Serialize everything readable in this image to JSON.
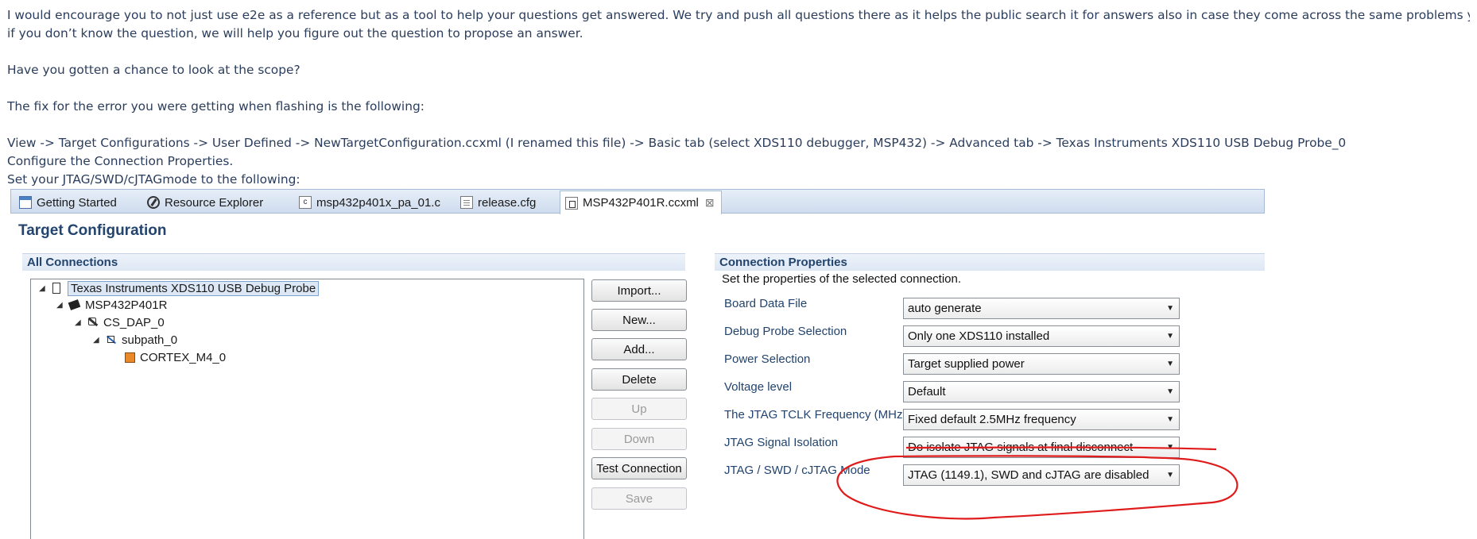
{
  "post": {
    "line1": "I would encourage you to not just use e2e as a reference but as a tool to help your questions get answered. We try and push all questions there as it helps the public search it for answers also in case they come across the same problems you do. Even",
    "line2": "if you don’t know the question, we will help you figure out the question to propose an answer.",
    "line3": "Have you gotten a chance to look at the scope?",
    "line4": "The fix for the error you were getting when flashing is the following:",
    "line5": "View -> Target Configurations -> User Defined -> NewTargetConfiguration.ccxml (I renamed this file) -> Basic tab (select XDS110 debugger, MSP432) -> Advanced tab -> Texas Instruments XDS110 USB Debug Probe_0",
    "line6": "Configure the Connection Properties.",
    "line7": "Set your JTAG/SWD/cJTAGmode to the following:"
  },
  "tabs": [
    {
      "label": "Getting Started",
      "icon": "window-icon"
    },
    {
      "label": "Resource Explorer",
      "icon": "compass-icon"
    },
    {
      "label": "msp432p401x_pa_01.c",
      "icon": "c-file-icon"
    },
    {
      "label": "release.cfg",
      "icon": "document-icon"
    },
    {
      "label": "MSP432P401R.ccxml",
      "icon": "ccxml-file-icon",
      "close": "⊠"
    }
  ],
  "target_config": {
    "title": "Target Configuration",
    "all_connections": "All Connections",
    "tree": [
      {
        "label": "Texas Instruments XDS110 USB Debug Probe",
        "icon": "probe-icon"
      },
      {
        "label": "MSP432P401R",
        "icon": "chip-icon"
      },
      {
        "label": "CS_DAP_0",
        "icon": "dap-icon"
      },
      {
        "label": "subpath_0",
        "icon": "subpath-icon"
      },
      {
        "label": "CORTEX_M4_0",
        "icon": "core-icon"
      }
    ],
    "buttons": {
      "import": "Import...",
      "new": "New...",
      "add": "Add...",
      "delete": "Delete",
      "up": "Up",
      "down": "Down",
      "test": "Test Connection",
      "save": "Save"
    }
  },
  "connection_properties": {
    "title": "Connection Properties",
    "subtitle": "Set the properties of the selected connection.",
    "props": [
      {
        "label": "Board Data File",
        "value": "auto generate"
      },
      {
        "label": "Debug Probe Selection",
        "value": "Only one XDS110 installed"
      },
      {
        "label": "Power Selection",
        "value": "Target supplied power"
      },
      {
        "label": "Voltage level",
        "value": "Default"
      },
      {
        "label": "The JTAG TCLK Frequency (MHz)",
        "value": "Fixed default 2.5MHz frequency"
      },
      {
        "label": "JTAG Signal Isolation",
        "value": "Do isolate JTAG signals at final disconnect"
      },
      {
        "label": "JTAG / SWD / cJTAG Mode",
        "value": "JTAG (1149.1), SWD and cJTAG are disabled"
      }
    ]
  },
  "colors": {
    "post_text": "#2b3d5c",
    "section_title": "#22446e",
    "annotation": "#e01b1b"
  }
}
